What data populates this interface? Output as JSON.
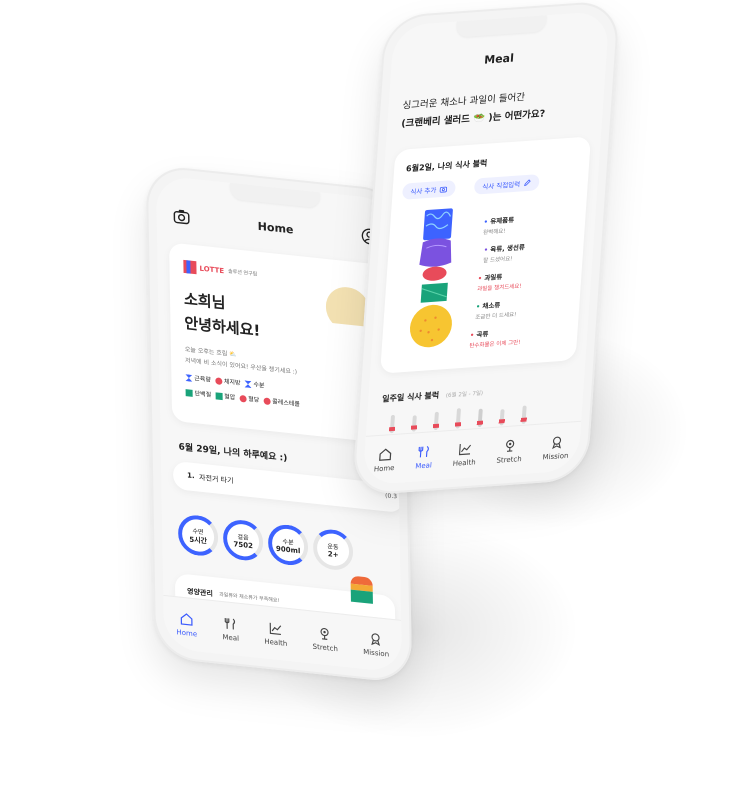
{
  "phone_home": {
    "header_title": "Home",
    "brand": {
      "logo_text": "LOTTE",
      "subtitle": "솔루션 연구팀"
    },
    "greeting": {
      "line1": "소희님",
      "line2": "안녕하세요!"
    },
    "weather": {
      "line1": "오늘 오후는 흐림 ⛅",
      "line2": "저녁에 비 소식이 있어요! 우산을 챙기세요 :)"
    },
    "legend": [
      {
        "label": "근육량",
        "color": "#3d63ff",
        "shape": "hourglass"
      },
      {
        "label": "체지방",
        "color": "#e84b5a",
        "shape": "circle"
      },
      {
        "label": "수분",
        "color": "#3d63ff",
        "shape": "hourglass"
      },
      {
        "label": "단백질",
        "color": "#1aa37a",
        "shape": "square"
      },
      {
        "label": "혈압",
        "color": "#1aa37a",
        "shape": "square"
      },
      {
        "label": "혈당",
        "color": "#e84b5a",
        "shape": "circle"
      },
      {
        "label": "콜레스테롤",
        "color": "#e84b5a",
        "shape": "circle"
      }
    ],
    "day_title": "6월 29일, 나의 하루예요 :)",
    "activity": {
      "index": "1.",
      "label": "자전거 타기",
      "value": "(0.3"
    },
    "stats": [
      {
        "label": "수면",
        "value": "5시간"
      },
      {
        "label": "걸음",
        "value": "7502"
      },
      {
        "label": "수분",
        "value": "900ml"
      },
      {
        "label": "운동",
        "value": "2+"
      }
    ],
    "nutrition": {
      "title": "영양관리",
      "desc": "과일류와 채소류가 부족해요!"
    },
    "tabs": [
      "Home",
      "Meal",
      "Health",
      "Stretch",
      "Mission"
    ],
    "active_tab": "Home"
  },
  "phone_meal": {
    "header_title": "Meal",
    "question": {
      "line1": "싱그러운 채소나 과일이 들어간",
      "line2": "(크랜베리 샐러드 🥗 )는 어떤가요?"
    },
    "record_title": "6월2일, 나의 식사 블럭",
    "chips": [
      "식사 추가",
      "식사 직접입력"
    ],
    "food_groups": [
      {
        "name": "유제품류",
        "desc": "완벽해요!",
        "warn": false
      },
      {
        "name": "육류, 생선류",
        "desc": "잘 드셨어요!",
        "warn": false
      },
      {
        "name": "과일류",
        "desc": "과일을 챙겨드세요!",
        "warn": true
      },
      {
        "name": "채소류",
        "desc": "조금만 더 드세요!",
        "warn": false
      },
      {
        "name": "곡류",
        "desc": "탄수화물은 이제 그만!",
        "warn": true
      }
    ],
    "weekly_title": "일주일 식사 블럭",
    "weekly_range": "(6월 2일 - 7일)",
    "tabs": [
      "Home",
      "Meal",
      "Health",
      "Stretch",
      "Mission"
    ],
    "active_tab": "Meal"
  },
  "colors": {
    "accent": "#3d63ff",
    "red": "#e84b5a",
    "green": "#1aa37a",
    "yellow": "#f7c531",
    "purple": "#7b52e0"
  }
}
